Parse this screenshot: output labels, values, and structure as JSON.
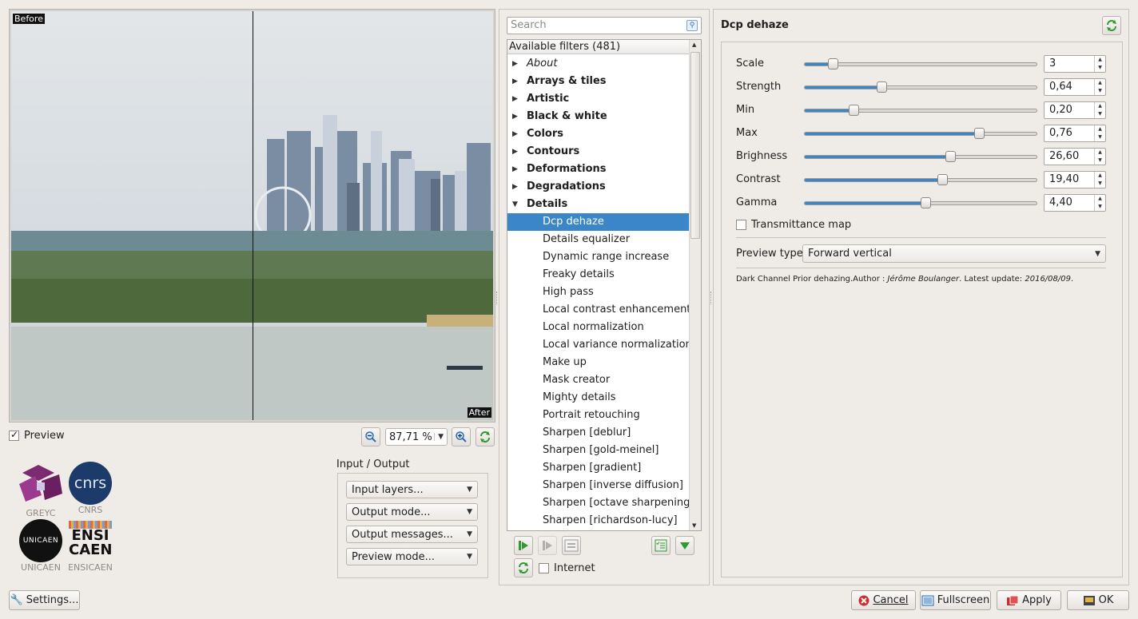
{
  "preview": {
    "before_label": "Before",
    "after_label": "After",
    "preview_checkbox_label": "Preview",
    "preview_checked": true,
    "zoom_value": "87,71 %"
  },
  "logos": {
    "greyc": "GREYC",
    "cnrs_caption": "CNRS",
    "cnrs_mark": "cnrs",
    "unicaen_caption": "UNICAEN",
    "unicaen_mark": "UNICAEN",
    "ensicaen_caption": "ENSICAEN",
    "ensicaen_mark_top": "ENSI",
    "ensicaen_mark_bottom": "CAEN"
  },
  "io": {
    "title": "Input / Output",
    "input_layers": "Input layers...",
    "output_mode": "Output mode...",
    "output_messages": "Output messages...",
    "preview_mode": "Preview mode..."
  },
  "filters": {
    "search_placeholder": "Search",
    "header": "Available filters (481)",
    "categories": [
      {
        "label": "About",
        "expanded": false
      },
      {
        "label": "Arrays & tiles",
        "expanded": false
      },
      {
        "label": "Artistic",
        "expanded": false
      },
      {
        "label": "Black & white",
        "expanded": false
      },
      {
        "label": "Colors",
        "expanded": false
      },
      {
        "label": "Contours",
        "expanded": false
      },
      {
        "label": "Deformations",
        "expanded": false
      },
      {
        "label": "Degradations",
        "expanded": false
      },
      {
        "label": "Details",
        "expanded": true
      }
    ],
    "details_items": [
      "Dcp dehaze",
      "Details equalizer",
      "Dynamic range increase",
      "Freaky details",
      "High pass",
      "Local contrast enhancement",
      "Local normalization",
      "Local variance normalization",
      "Make up",
      "Mask creator",
      "Mighty details",
      "Portrait retouching",
      "Sharpen [deblur]",
      "Sharpen [gold-meinel]",
      "Sharpen [gradient]",
      "Sharpen [inverse diffusion]",
      "Sharpen [octave sharpening]",
      "Sharpen [richardson-lucy]"
    ],
    "selected_item": "Dcp dehaze",
    "internet_label": "Internet",
    "internet_checked": false
  },
  "params": {
    "title": "Dcp dehaze",
    "sliders": [
      {
        "label": "Scale",
        "value": "3",
        "fraction": 0.12
      },
      {
        "label": "Strength",
        "value": "0,64",
        "fraction": 0.33
      },
      {
        "label": "Min",
        "value": "0,20",
        "fraction": 0.21
      },
      {
        "label": "Max",
        "value": "0,76",
        "fraction": 0.75
      },
      {
        "label": "Brighness",
        "value": "26,60",
        "fraction": 0.627
      },
      {
        "label": "Contrast",
        "value": "19,40",
        "fraction": 0.593
      },
      {
        "label": "Gamma",
        "value": "4,40",
        "fraction": 0.52
      }
    ],
    "transmittance_label": "Transmittance map",
    "transmittance_checked": false,
    "preview_type_label": "Preview type",
    "preview_type_value": "Forward vertical",
    "info_prefix": "Dark Channel Prior dehazing.Author : ",
    "info_author": "Jérôme Boulanger",
    "info_middle": ". Latest update: ",
    "info_date": "2016/08/09",
    "info_suffix": "."
  },
  "bottom": {
    "settings": "Settings...",
    "cancel": "Cancel",
    "fullscreen": "Fullscreen",
    "apply": "Apply",
    "ok": "OK"
  },
  "colors": {
    "selection": "#3b86c8",
    "refresh_green": "#2f9a2f",
    "cancel_red": "#d22b2b"
  }
}
